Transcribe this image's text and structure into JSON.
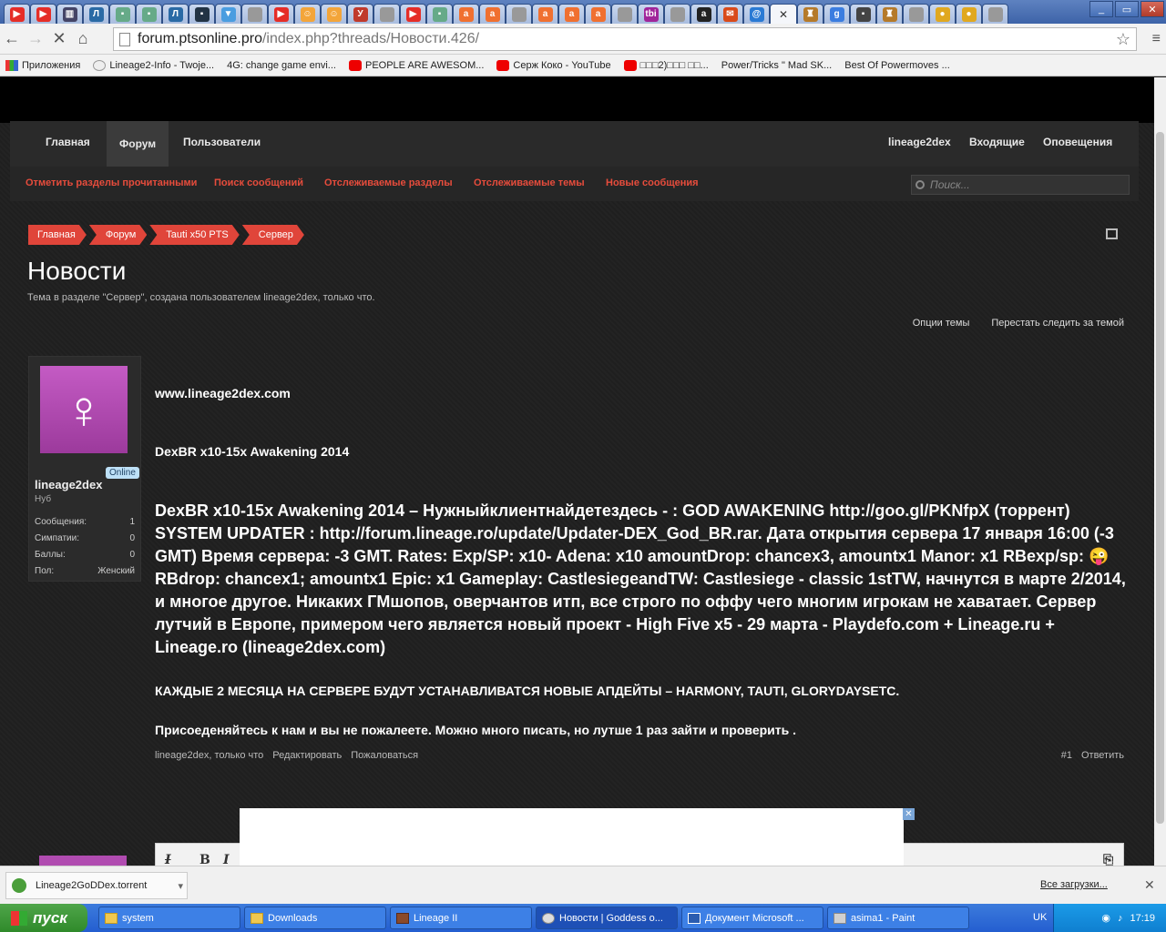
{
  "browser": {
    "tabs": [
      {
        "icon": "youtube-icon",
        "color": "#e52d27",
        "glyph": "▶"
      },
      {
        "icon": "youtube-icon",
        "color": "#e52d27",
        "glyph": "▶"
      },
      {
        "icon": "page-icon",
        "color": "#446",
        "glyph": "▥"
      },
      {
        "icon": "tauti-icon",
        "color": "#2a6aa5",
        "glyph": "Л"
      },
      {
        "icon": "page-icon",
        "color": "#6a8",
        "glyph": "▪"
      },
      {
        "icon": "page-icon",
        "color": "#6a8",
        "glyph": "▪"
      },
      {
        "icon": "tauti-icon",
        "color": "#2a6aa5",
        "glyph": "Л"
      },
      {
        "icon": "page-icon",
        "color": "#234",
        "glyph": "▪"
      },
      {
        "icon": "page-icon",
        "color": "#4a9de0",
        "glyph": "▼"
      },
      {
        "icon": "page-icon",
        "color": "#999",
        "glyph": ""
      },
      {
        "icon": "youtube-icon",
        "color": "#e52d27",
        "glyph": "▶"
      },
      {
        "icon": "smile-icon",
        "color": "#f3a53a",
        "glyph": "☺"
      },
      {
        "icon": "smile-icon",
        "color": "#f3a53a",
        "glyph": "☺"
      },
      {
        "icon": "page-icon",
        "color": "#c0392b",
        "glyph": "У"
      },
      {
        "icon": "page-icon",
        "color": "#999",
        "glyph": ""
      },
      {
        "icon": "youtube-icon",
        "color": "#e52d27",
        "glyph": "▶"
      },
      {
        "icon": "page-icon",
        "color": "#6a8",
        "glyph": "▪"
      },
      {
        "icon": "avito-icon",
        "color": "#f07030",
        "glyph": "a"
      },
      {
        "icon": "avito-icon",
        "color": "#f07030",
        "glyph": "a"
      },
      {
        "icon": "page-icon",
        "color": "#999",
        "glyph": ""
      },
      {
        "icon": "avito-icon",
        "color": "#f07030",
        "glyph": "a"
      },
      {
        "icon": "avito-icon",
        "color": "#f07030",
        "glyph": "a"
      },
      {
        "icon": "avito-icon",
        "color": "#f07030",
        "glyph": "a"
      },
      {
        "icon": "page-icon",
        "color": "#999",
        "glyph": ""
      },
      {
        "icon": "tbi-icon",
        "color": "#a0259a",
        "glyph": "tbi"
      },
      {
        "icon": "page-icon",
        "color": "#999",
        "glyph": ""
      },
      {
        "icon": "amazon-icon",
        "color": "#222",
        "glyph": "a"
      },
      {
        "icon": "mail-icon",
        "color": "#d94a1a",
        "glyph": "✉"
      },
      {
        "icon": "at-icon",
        "color": "#2a7ad4",
        "glyph": "@"
      }
    ],
    "tabs_right": [
      {
        "icon": "game-icon",
        "color": "#b57a2a",
        "glyph": "♜"
      },
      {
        "icon": "google-icon",
        "color": "#3b7de0",
        "glyph": "g"
      },
      {
        "icon": "page-icon",
        "color": "#444",
        "glyph": "▪"
      },
      {
        "icon": "game-icon",
        "color": "#b57a2a",
        "glyph": "♜"
      },
      {
        "icon": "page-icon",
        "color": "#999",
        "glyph": ""
      },
      {
        "icon": "coin-icon",
        "color": "#e0a820",
        "glyph": "●"
      },
      {
        "icon": "coin-icon",
        "color": "#e0a820",
        "glyph": "●"
      },
      {
        "icon": "page-icon",
        "color": "#999",
        "glyph": ""
      }
    ],
    "url_host": "forum.ptsonline.pro",
    "url_path": "/index.php?threads/Новости.426/",
    "bookmarks": [
      {
        "label": "Приложения",
        "icon": "apps"
      },
      {
        "label": "Lineage2-Info - Twoje...",
        "icon": "l2"
      },
      {
        "label": "4G: change game envi...",
        "icon": "page"
      },
      {
        "label": "PEOPLE ARE AWESOM...",
        "icon": "yt"
      },
      {
        "label": "Серж Коко - YouTube",
        "icon": "yt"
      },
      {
        "label": "□□□2)□□□ □□...",
        "icon": "yt"
      },
      {
        "label": "Power/Tricks \" Mad SK...",
        "icon": "page"
      },
      {
        "label": "Best Of Powermoves ...",
        "icon": "page"
      }
    ]
  },
  "forum": {
    "nav": {
      "home": "Главная",
      "forum": "Форум",
      "users": "Пользователи",
      "user": "lineage2dex",
      "inbox": "Входящие",
      "alerts": "Оповещения"
    },
    "subnav": [
      "Отметить разделы прочитанными",
      "Поиск сообщений",
      "Отслеживаемые разделы",
      "Отслеживаемые темы",
      "Новые сообщения"
    ],
    "search_placeholder": "Поиск...",
    "breadcrumbs": [
      "Главная",
      "Форум",
      "Tauti x50 PTS",
      "Сервер"
    ],
    "title": "Новости",
    "description": "Тема в разделе \"Сервер\", создана пользователем lineage2dex, только что.",
    "topic_options": "Опции темы",
    "unwatch": "Перестать следить за темой"
  },
  "author": {
    "online": "Online",
    "name": "lineage2dex",
    "rank": "Нуб",
    "stats": [
      {
        "label": "Сообщения:",
        "value": "1"
      },
      {
        "label": "Симпатии:",
        "value": "0"
      },
      {
        "label": "Баллы:",
        "value": "0"
      },
      {
        "label": "Пол:",
        "value": "Женский"
      }
    ]
  },
  "post": {
    "site": "www.lineage2dex.com",
    "subtitle": "DexBR x10-15x Awakening 2014",
    "body": "DexBR x10-15x Awakening 2014 – Нужныйклиентнайдетездесь - : GOD AWAKENING http://goo.gl/PKNfpX (торрент) SYSTEM UPDATER : http://forum.lineage.ro/update/Updater-DEX_God_BR.rar. Дата открытия сервера 17 января 16:00 (-3 GMT) Время сервера: -3 GMT. Rates: Exp/SP: x10- Adena: x10 amountDrop: chancex3, amountx1 Manor: x1 RBexp/sp: 😜 RBdrop: chancex1; amountx1 Epic: x1 Gameplay: CastlesiegeandTW: Castlesiege - classic 1stTW, начнутся в марте 2/2014, и многое другое. Никаких ГМшопов, оверчантов итп, все строго по оффу чего многим игрокам не хаватает. Сервер лутчий в Европе, примером чего является новый проект - High Five x5 - 29 марта - Playdefo.com + Lineage.ru + Lineage.ro (lineage2dex.com)",
    "updates": "КАЖДЫЕ 2 МЕСЯЦА НА СЕРВЕРЕ БУДУТ УСТАНАВЛИВАТСЯ НОВЫЕ АПДЕЙТЫ – HARMONY, TAUTI, GLORYDAYSETC.",
    "invite": "Присоеденяйтесь к нам и вы не пожалеете. Можно много писать, но лутше 1 раз зайти и проверить .",
    "meta": "lineage2dex, только что",
    "edit": "Редактировать",
    "report": "Пожаловаться",
    "number": "#1",
    "reply": "Ответить"
  },
  "download": {
    "file": "Lineage2GoDDex.torrent",
    "all": "Все загрузки..."
  },
  "taskbar": {
    "start": "пуск",
    "tasks": [
      "system",
      "Downloads",
      "Lineage II",
      "Новости | Goddess o...",
      "Документ Microsoft ...",
      "asima1 - Paint"
    ],
    "lang": "UK",
    "time": "17:19"
  }
}
